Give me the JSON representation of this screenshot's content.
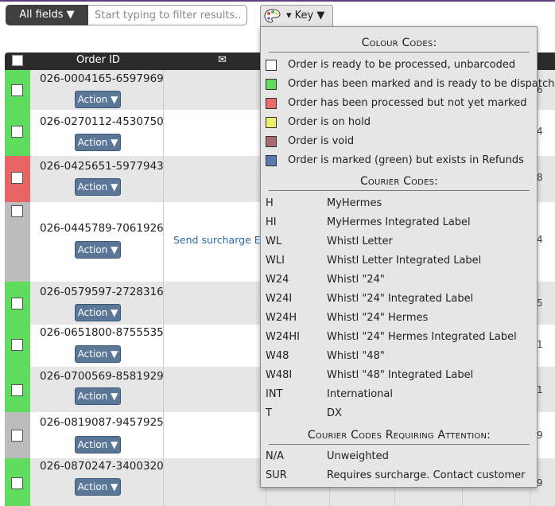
{
  "filter": {
    "all_fields_label": "All fields ▼",
    "placeholder": "Start typing to filter results..."
  },
  "key_button": {
    "label": "▾ Key ▼"
  },
  "table": {
    "headers": {
      "order_id": "Order ID",
      "mail": "✉"
    },
    "rows": [
      {
        "order_id": "026-0004165-6597969",
        "action": "Action ▼",
        "status_color": "#5ddc5d",
        "bg": "#e6e6e6",
        "right": "6",
        "extra": ""
      },
      {
        "order_id": "026-0270112-4530750",
        "action": "Action ▼",
        "status_color": "#5ddc5d",
        "bg": "#ffffff",
        "right": "4",
        "extra": ""
      },
      {
        "order_id": "026-0425651-5977943",
        "action": "Action ▼",
        "status_color": "#e86565",
        "bg": "#e6e6e6",
        "right": "8",
        "extra": ""
      },
      {
        "order_id": "026-0445789-7061926",
        "action": "Action ▼",
        "status_color": "#bcbcbc",
        "bg": "#ffffff",
        "right": "4",
        "extra": "Send surcharge Em"
      },
      {
        "order_id": "026-0579597-2728316",
        "action": "Action ▼",
        "status_color": "#5ddc5d",
        "bg": "#e6e6e6",
        "right": "5",
        "extra": ""
      },
      {
        "order_id": "026-0651800-8755535",
        "action": "Action ▼",
        "status_color": "#5ddc5d",
        "bg": "#ffffff",
        "right": "1",
        "extra": ""
      },
      {
        "order_id": "026-0700569-8581929",
        "action": "Action ▼",
        "status_color": "#5ddc5d",
        "bg": "#e6e6e6",
        "right": "1",
        "extra": ""
      },
      {
        "order_id": "026-0819087-9457925",
        "action": "Action ▼",
        "status_color": "#bcbcbc",
        "bg": "#ffffff",
        "right": "9",
        "extra": ""
      },
      {
        "order_id": "026-0870247-3400320",
        "action": "Action ▼",
        "status_color": "#5ddc5d",
        "bg": "#e6e6e6",
        "right": "9",
        "extra": ""
      }
    ]
  },
  "key_panel": {
    "colour_title": "Colour Codes:",
    "colour_codes": [
      {
        "color": "#ffffff",
        "text": "Order is ready to be processed, unbarcoded"
      },
      {
        "color": "#5ddc5d",
        "text": "Order has been marked and is ready to be dispatched"
      },
      {
        "color": "#ee6a6a",
        "text": "Order has been processed but not yet marked"
      },
      {
        "color": "#eeee6a",
        "text": "Order is on hold"
      },
      {
        "color": "#a86a6a",
        "text": "Order is void"
      },
      {
        "color": "#5a78b0",
        "text": "Order is marked (green) but exists in Refunds"
      }
    ],
    "courier_title": "Courier Codes:",
    "courier_codes": [
      {
        "code": "H",
        "desc": "MyHermes"
      },
      {
        "code": "HI",
        "desc": "MyHermes Integrated Label"
      },
      {
        "code": "WL",
        "desc": "Whistl Letter"
      },
      {
        "code": "WLI",
        "desc": "Whistl Letter Integrated Label"
      },
      {
        "code": "W24",
        "desc": "Whistl \"24\""
      },
      {
        "code": "W24I",
        "desc": "Whistl \"24\" Integrated Label"
      },
      {
        "code": "W24H",
        "desc": "Whistl \"24\" Hermes"
      },
      {
        "code": "W24HI",
        "desc": "Whistl \"24\" Hermes Integrated Label"
      },
      {
        "code": "W48",
        "desc": "Whistl \"48\""
      },
      {
        "code": "W48I",
        "desc": "Whistl \"48\" Integrated Label"
      },
      {
        "code": "INT",
        "desc": "International"
      },
      {
        "code": "T",
        "desc": "DX"
      }
    ],
    "attention_title": "Courier Codes Requiring Attention:",
    "attention_codes": [
      {
        "code": "N/A",
        "desc": "Unweighted"
      },
      {
        "code": "SUR",
        "desc": "Requires surcharge. Contact customer"
      }
    ]
  }
}
